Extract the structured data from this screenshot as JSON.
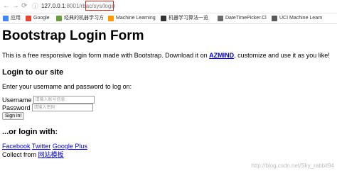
{
  "browser": {
    "back_icon": "←",
    "forward_icon": "→",
    "reload_icon": "⟳",
    "info_icon": "ⓘ",
    "url_host": "127.0.0.1",
    "url_port": ":8001",
    "url_path": "/rbac/sys/login"
  },
  "bookmarks": [
    {
      "label": "应用",
      "color": "#4285f4"
    },
    {
      "label": "Google",
      "color": "#ea4335"
    },
    {
      "label": "经典的机器学习方",
      "color": "#6a9e3b"
    },
    {
      "label": "Machine Learning",
      "color": "#ff9900"
    },
    {
      "label": "机器学习算法一览",
      "color": "#333333"
    },
    {
      "label": "DateTimePicker.Cl",
      "color": "#6b6b6b"
    },
    {
      "label": "UCI Machine Learn",
      "color": "#5a5a5a"
    }
  ],
  "page": {
    "title": "Bootstrap Login Form",
    "intro_before": "This is a free responsive login form made with Bootstrap. Download it on ",
    "intro_link": "AZMIND",
    "intro_after": ", customize and use it as you like!",
    "login_heading": "Login to our site",
    "prompt": "Enter your username and password to log on:",
    "username_label": "Username",
    "username_placeholder": "请输入账号信息",
    "password_label": "Password",
    "password_placeholder": "请输入密码",
    "signin_label": "Sign in!",
    "or_heading": "...or login with:",
    "social_links": [
      "Facebook",
      "Twitter",
      "Google Plus"
    ],
    "collect_prefix": "Collect from ",
    "collect_link": "网站模板"
  },
  "watermark": "http://blog.csdn.net/Sky_rabbit94"
}
